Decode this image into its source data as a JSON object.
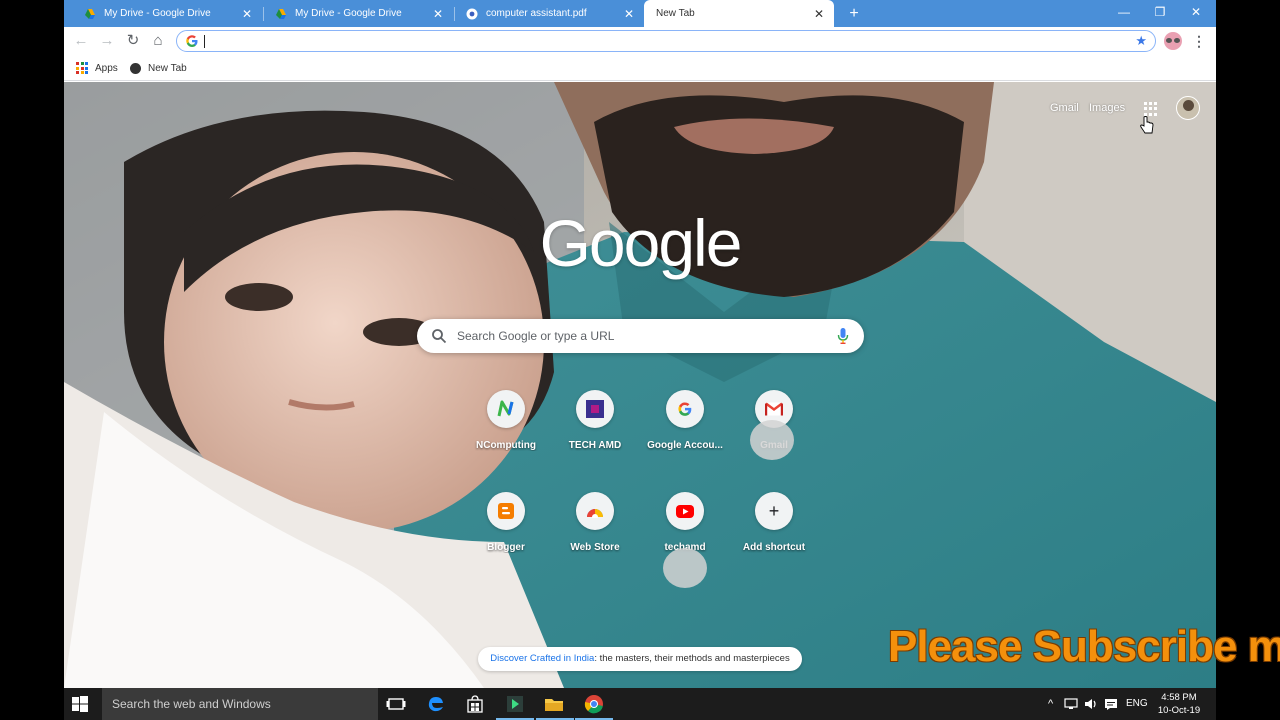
{
  "tabs": [
    {
      "title": "My Drive - Google Drive",
      "icon": "drive-icon"
    },
    {
      "title": "My Drive - Google Drive",
      "icon": "drive-icon"
    },
    {
      "title": "computer assistant.pdf",
      "icon": "chrome-icon"
    },
    {
      "title": "New Tab",
      "icon": "chrome-icon",
      "active": true
    }
  ],
  "window_controls": {
    "minimize": "—",
    "maximize": "❐",
    "close": "✕"
  },
  "toolbar": {
    "address_value": ""
  },
  "bookmarks": [
    {
      "label": "Apps",
      "icon": "apps-icon"
    },
    {
      "label": "New Tab",
      "icon": "globe-icon"
    }
  ],
  "ntp": {
    "gmail_link": "Gmail",
    "images_link": "Images",
    "logo": "Google",
    "search_placeholder": "Search Google or type a URL",
    "shortcuts": [
      {
        "label": "NComputing",
        "icon": "ncomputing-icon"
      },
      {
        "label": "TECH AMD",
        "icon": "techamd-icon"
      },
      {
        "label": "Google Accou...",
        "icon": "google-g-icon"
      },
      {
        "label": "Gmail",
        "icon": "gmail-icon"
      },
      {
        "label": "Blogger",
        "icon": "blogger-icon"
      },
      {
        "label": "Web Store",
        "icon": "webstore-icon"
      },
      {
        "label": "techamd",
        "icon": "youtube-icon"
      },
      {
        "label": "Add shortcut",
        "icon": "plus-icon"
      }
    ],
    "discover_link": "Discover Crafted in India",
    "discover_text": ": the masters, their methods and masterpieces"
  },
  "overlay": {
    "subscribe_text": "Please Subscribe m"
  },
  "taskbar": {
    "search_placeholder": "Search the web and Windows",
    "language": "ENG",
    "time": "4:58 PM",
    "date": "10-Oct-19"
  },
  "colors": {
    "tab_strip": "#4a8fd8",
    "accent_blue": "#1a73e8",
    "subscribe_orange": "#f4900c",
    "taskbar": "#1c1c1c"
  }
}
